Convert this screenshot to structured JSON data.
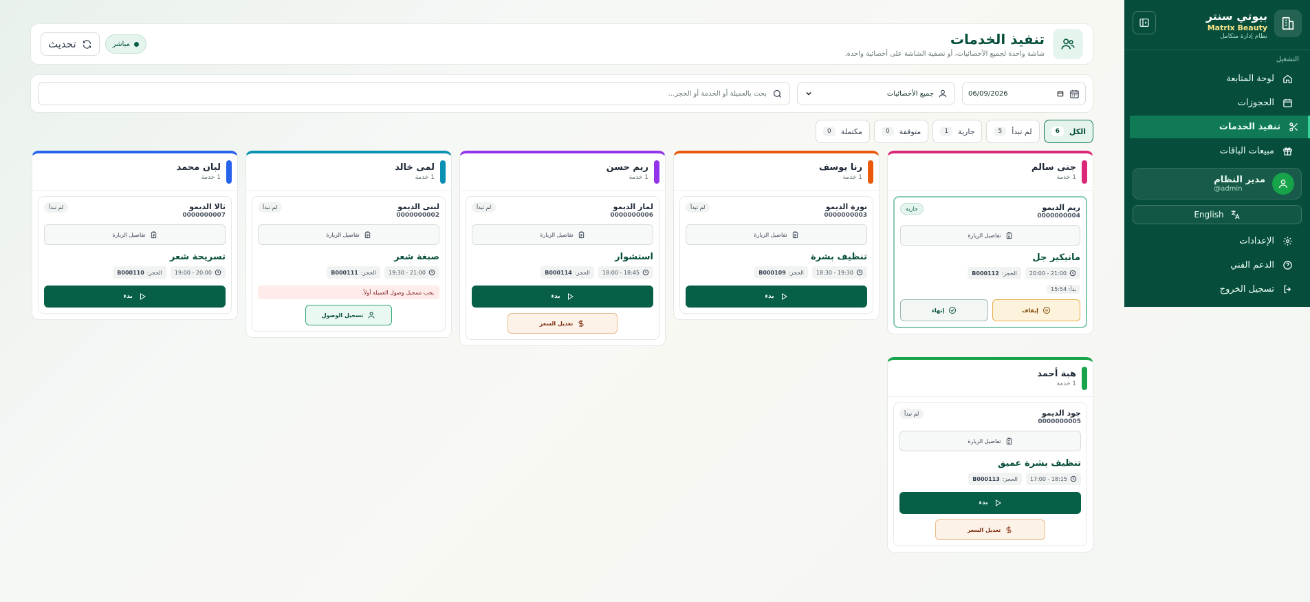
{
  "sidebar": {
    "brand_name": "بيوتي سنتر",
    "brand_sub": "Matrix Beauty",
    "brand_desc": "نظام إدارة متكامل",
    "section_label": "التشغيل",
    "items": [
      {
        "label": "لوحة المتابعة",
        "icon": "home-icon"
      },
      {
        "label": "الحجوزات",
        "icon": "calendar-icon"
      },
      {
        "label": "تنفيذ الخدمات",
        "icon": "scissors-icon"
      },
      {
        "label": "مبيعات الباقات",
        "icon": "gift-icon"
      }
    ],
    "user_name": "مدير النظام",
    "user_handle": "@admin",
    "language_label": "English",
    "bottom_items": [
      {
        "label": "الإعدادات",
        "icon": "gear-icon"
      },
      {
        "label": "الدعم الفني",
        "icon": "help-icon"
      },
      {
        "label": "تسجيل الخروج",
        "icon": "logout-icon"
      }
    ]
  },
  "header": {
    "title": "تنفيذ الخدمات",
    "subtitle": "شاشة واحدة لجميع الأخصائيات، أو تصفية الشاشة على أخصائية واحدة.",
    "live_label": "مباشر",
    "refresh_label": "تحديث"
  },
  "filters": {
    "date_value": "06/09/2026",
    "staff_value": "جميع الأخصائيات",
    "search_placeholder": "بحث بالعميلة أو الخدمة أو الحجز..."
  },
  "tabs": [
    {
      "label": "الكل",
      "count": "6"
    },
    {
      "label": "لم تبدأ",
      "count": "5"
    },
    {
      "label": "جارية",
      "count": "1"
    },
    {
      "label": "متوقفة",
      "count": "0"
    },
    {
      "label": "مكتملة",
      "count": "0"
    }
  ],
  "columns": [
    {
      "name": "جنى سالم",
      "count": "1 خدمة",
      "color": "#db2777",
      "card": {
        "client": "ريم الديمو",
        "phone": "0000000004",
        "status": "جارية",
        "visit": "تفاصيل الزيارة",
        "service": "مانيكير جل",
        "time": "20:00 - 21:00",
        "booking_label": "الحجز:",
        "booking": "B000112",
        "started": "بدأ: 15:54",
        "pause": "إيقاف",
        "finish": "إنهاء"
      }
    },
    {
      "name": "رنا يوسف",
      "count": "1 خدمة",
      "color": "#ea580c",
      "card": {
        "client": "نورة الديمو",
        "phone": "0000000003",
        "status": "لم تبدأ",
        "visit": "تفاصيل الزيارة",
        "service": "تنظيف بشرة",
        "time": "18:30 - 19:30",
        "booking_label": "الحجز:",
        "booking": "B000109",
        "start": "بدء"
      }
    },
    {
      "name": "ريم حسن",
      "count": "1 خدمة",
      "color": "#9333ea",
      "card": {
        "client": "لمار الديمو",
        "phone": "0000000006",
        "status": "لم تبدأ",
        "visit": "تفاصيل الزيارة",
        "service": "استشوار",
        "time": "18:00 - 18:45",
        "booking_label": "الحجز:",
        "booking": "B000114",
        "start": "بدء",
        "price": "تعديل السعر"
      }
    },
    {
      "name": "لمى خالد",
      "count": "1 خدمة",
      "color": "#0891b2",
      "card": {
        "client": "لبنى الديمو",
        "phone": "0000000002",
        "status": "لم تبدأ",
        "visit": "تفاصيل الزيارة",
        "service": "صبغة شعر",
        "time": "19:30 - 21:00",
        "booking_label": "الحجز:",
        "booking": "B000111",
        "warning": "يجب تسجيل وصول العميلة أولاً.",
        "arrive": "تسجيل الوصول"
      }
    },
    {
      "name": "لبان محمد",
      "count": "1 خدمة",
      "color": "#2563eb",
      "card": {
        "client": "ثالا الديمو",
        "phone": "0000000007",
        "status": "لم تبدأ",
        "visit": "تفاصيل الزيارة",
        "service": "تسريحة شعر",
        "time": "19:00 - 20:00",
        "booking_label": "الحجز:",
        "booking": "B000110",
        "start": "بدء"
      }
    },
    {
      "name": "هبة أحمد",
      "count": "1 خدمة",
      "color": "#16a34a",
      "card": {
        "client": "جود الديمو",
        "phone": "0000000005",
        "status": "لم تبدأ",
        "visit": "تفاصيل الزيارة",
        "service": "تنظيف بشرة عميق",
        "time": "17:00 - 18:15",
        "booking_label": "الحجز:",
        "booking": "B000113",
        "start": "بدء",
        "price": "تعديل السعر"
      }
    }
  ]
}
